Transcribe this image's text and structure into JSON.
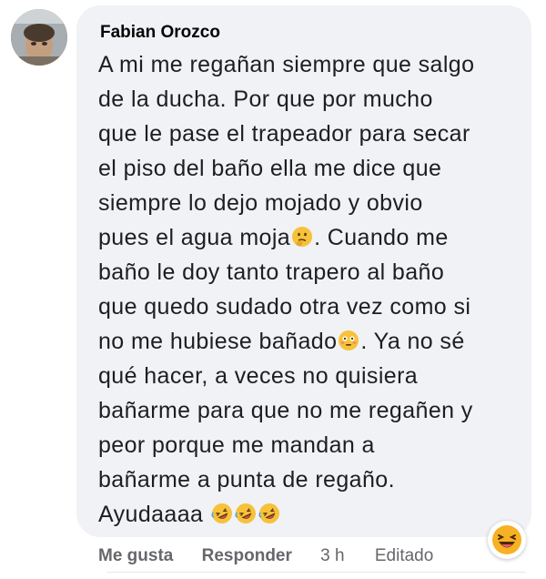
{
  "comment": {
    "author": "Fabian Orozco",
    "lines": [
      "A mi me regañan siempre que salgo",
      "de la ducha. Por que por mucho",
      "que le pase el trapeador para secar",
      "el piso del baño ella me dice que",
      "siempre lo dejo mojado y obvio",
      "pues el agua moja",
      ". Cuando me",
      "baño le doy tanto trapero al baño",
      "que quedo sudado otra vez como si",
      "no me hubiese bañado",
      ". Ya no sé",
      "qué hacer, a veces no quisiera",
      "bañarme para que no me regañen y",
      "peor porque me mandan a",
      "bañarme a punta de regaño.",
      "Ayudaaaa"
    ],
    "emojis": {
      "line6": "thinking-face-emoji",
      "line10": "flushed-face-emoji",
      "line16": [
        "rolling-laughing-emoji",
        "rolling-laughing-emoji",
        "rolling-laughing-emoji"
      ]
    }
  },
  "actions": {
    "like": "Me gusta",
    "reply": "Responder",
    "time": "3 h",
    "edited": "Editado"
  },
  "reaction": {
    "icon": "haha-reaction-icon",
    "color": "#f7b125"
  },
  "colors": {
    "bubble": "#f0f2f5",
    "secondary_text": "#65676b"
  }
}
